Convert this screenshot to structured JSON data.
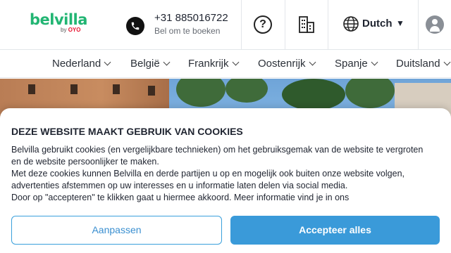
{
  "header": {
    "logo_text": "belvilla",
    "logo_sub_prefix": "by",
    "logo_sub_brand": "OYO",
    "phone_number": "+31 885016722",
    "phone_caption": "Bel om te boeken",
    "help_glyph": "?",
    "language": "Dutch",
    "icons": [
      "phone-icon",
      "help-icon",
      "building-icon",
      "globe-icon",
      "caret-down-icon",
      "account-icon"
    ]
  },
  "nav": {
    "countries": [
      "Nederland",
      "België",
      "Frankrijk",
      "Oostenrijk",
      "Spanje",
      "Duitsland"
    ]
  },
  "cookie": {
    "title": "DEZE WEBSITE MAAKT GEBRUIK VAN COOKIES",
    "paragraph_1": "Belvilla gebruikt cookies (en vergelijkbare technieken) om het gebruiksgemak van de website te vergroten en de website persoonlijker te maken.",
    "paragraph_2": "Met deze cookies kunnen Belvilla en derde partijen u op en mogelijk ook buiten onze website volgen, advertenties afstemmen op uw interesses en u informatie laten delen via social media.",
    "paragraph_3": "Door op \"accepteren\" te klikken gaat u hiermee akkoord. Meer informatie vind je in ons",
    "customize_label": "Aanpassen",
    "accept_label": "Accepteer alles"
  },
  "colors": {
    "brand_green": "#22b573",
    "oyo_red": "#e8112d",
    "accent_blue": "#3a9ad9"
  }
}
